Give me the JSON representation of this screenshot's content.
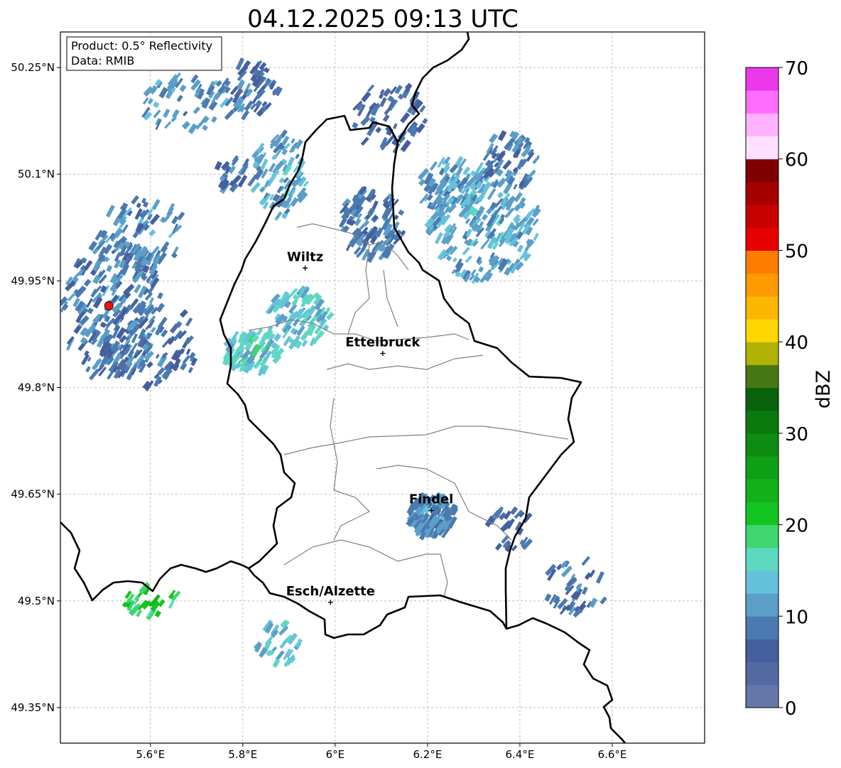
{
  "title": "04.12.2025 09:13 UTC",
  "info_box": {
    "product": "Product: 0.5° Reflectivity",
    "data": "Data: RMIB"
  },
  "axes": {
    "lon_ticks": [
      {
        "value": 5.6,
        "label": "5.6°E"
      },
      {
        "value": 5.8,
        "label": "5.8°E"
      },
      {
        "value": 6.0,
        "label": "6°E"
      },
      {
        "value": 6.2,
        "label": "6.2°E"
      },
      {
        "value": 6.4,
        "label": "6.4°E"
      },
      {
        "value": 6.6,
        "label": "6.6°E"
      }
    ],
    "lat_ticks": [
      {
        "value": 50.25,
        "label": "50.25°N"
      },
      {
        "value": 50.1,
        "label": "50.1°N"
      },
      {
        "value": 49.95,
        "label": "49.95°N"
      },
      {
        "value": 49.8,
        "label": "49.8°N"
      },
      {
        "value": 49.65,
        "label": "49.65°N"
      },
      {
        "value": 49.5,
        "label": "49.5°N"
      },
      {
        "value": 49.35,
        "label": "49.35°N"
      }
    ],
    "lon_range": [
      5.405,
      6.8
    ],
    "lat_range": [
      49.3,
      50.3
    ],
    "grid": true
  },
  "cities": [
    {
      "name": "Wiltz",
      "lon": 5.935,
      "lat": 49.968
    },
    {
      "name": "Ettelbruck",
      "lon": 6.103,
      "lat": 49.848
    },
    {
      "name": "Findel",
      "lon": 6.208,
      "lat": 49.627
    },
    {
      "name": "Esch/Alzette",
      "lon": 5.99,
      "lat": 49.498
    }
  ],
  "radar_site": {
    "lon": 5.51,
    "lat": 49.915,
    "color": "#ee1111"
  },
  "colorbar": {
    "unit": "dBZ",
    "min": 0,
    "max": 70,
    "step": 2.5,
    "tick_labels": [
      "0",
      "10",
      "20",
      "30",
      "40",
      "50",
      "60",
      "70"
    ],
    "colors": [
      "#6477a8",
      "#546aa2",
      "#455f9e",
      "#4a7ab0",
      "#5b9fc8",
      "#66c2dc",
      "#5fd8c2",
      "#3fd670",
      "#12c41f",
      "#13b21a",
      "#0f9f15",
      "#0e8c11",
      "#0b780e",
      "#08620b",
      "#477713",
      "#b0b205",
      "#ffd700",
      "#fdb700",
      "#ff9a00",
      "#fe7c00",
      "#e70000",
      "#c80000",
      "#a60000",
      "#7e0000",
      "#ffe0ff",
      "#ffb3ff",
      "#ff6eff",
      "#ec38ec"
    ]
  },
  "chart_data": {
    "type": "heatmap",
    "title": "04.12.2025 09:13 UTC",
    "xlabel": "",
    "ylabel": "",
    "colorbar_label": "dBZ",
    "value_range": [
      0,
      70
    ],
    "echo_cells": [
      {
        "lon": 5.82,
        "lat": 50.22,
        "rlon": 0.06,
        "rlat": 0.04,
        "dbz": 8,
        "count": 55
      },
      {
        "lon": 5.68,
        "lat": 50.2,
        "rlon": 0.1,
        "rlat": 0.04,
        "dbz": 11,
        "count": 60
      },
      {
        "lon": 5.88,
        "lat": 50.1,
        "rlon": 0.06,
        "rlat": 0.06,
        "dbz": 12,
        "count": 90
      },
      {
        "lon": 5.78,
        "lat": 50.1,
        "rlon": 0.05,
        "rlat": 0.02,
        "dbz": 8,
        "count": 25
      },
      {
        "lon": 6.12,
        "lat": 50.18,
        "rlon": 0.08,
        "rlat": 0.05,
        "dbz": 7,
        "count": 60
      },
      {
        "lon": 6.08,
        "lat": 50.03,
        "rlon": 0.07,
        "rlat": 0.05,
        "dbz": 9,
        "count": 110
      },
      {
        "lon": 6.25,
        "lat": 50.08,
        "rlon": 0.07,
        "rlat": 0.04,
        "dbz": 11,
        "count": 80
      },
      {
        "lon": 6.32,
        "lat": 50.03,
        "rlon": 0.12,
        "rlat": 0.08,
        "dbz": 12,
        "count": 220
      },
      {
        "lon": 6.38,
        "lat": 50.12,
        "rlon": 0.06,
        "rlat": 0.04,
        "dbz": 9,
        "count": 60
      },
      {
        "lon": 5.52,
        "lat": 49.91,
        "rlon": 0.11,
        "rlat": 0.1,
        "dbz": 9,
        "count": 230
      },
      {
        "lon": 5.58,
        "lat": 50.02,
        "rlon": 0.1,
        "rlat": 0.05,
        "dbz": 10,
        "count": 70
      },
      {
        "lon": 5.6,
        "lat": 49.86,
        "rlon": 0.11,
        "rlat": 0.06,
        "dbz": 7,
        "count": 90
      },
      {
        "lon": 5.82,
        "lat": 49.85,
        "rlon": 0.06,
        "rlat": 0.03,
        "dbz": 15,
        "count": 90
      },
      {
        "lon": 5.92,
        "lat": 49.9,
        "rlon": 0.07,
        "rlat": 0.04,
        "dbz": 14,
        "count": 90
      },
      {
        "lon": 6.21,
        "lat": 49.62,
        "rlon": 0.05,
        "rlat": 0.03,
        "dbz": 10,
        "count": 140
      },
      {
        "lon": 5.6,
        "lat": 49.5,
        "rlon": 0.06,
        "rlat": 0.02,
        "dbz": 20,
        "count": 30
      },
      {
        "lon": 5.88,
        "lat": 49.44,
        "rlon": 0.05,
        "rlat": 0.03,
        "dbz": 14,
        "count": 35
      },
      {
        "lon": 6.52,
        "lat": 49.52,
        "rlon": 0.07,
        "rlat": 0.04,
        "dbz": 8,
        "count": 40
      },
      {
        "lon": 6.38,
        "lat": 49.6,
        "rlon": 0.05,
        "rlat": 0.03,
        "dbz": 7,
        "count": 25
      }
    ]
  }
}
